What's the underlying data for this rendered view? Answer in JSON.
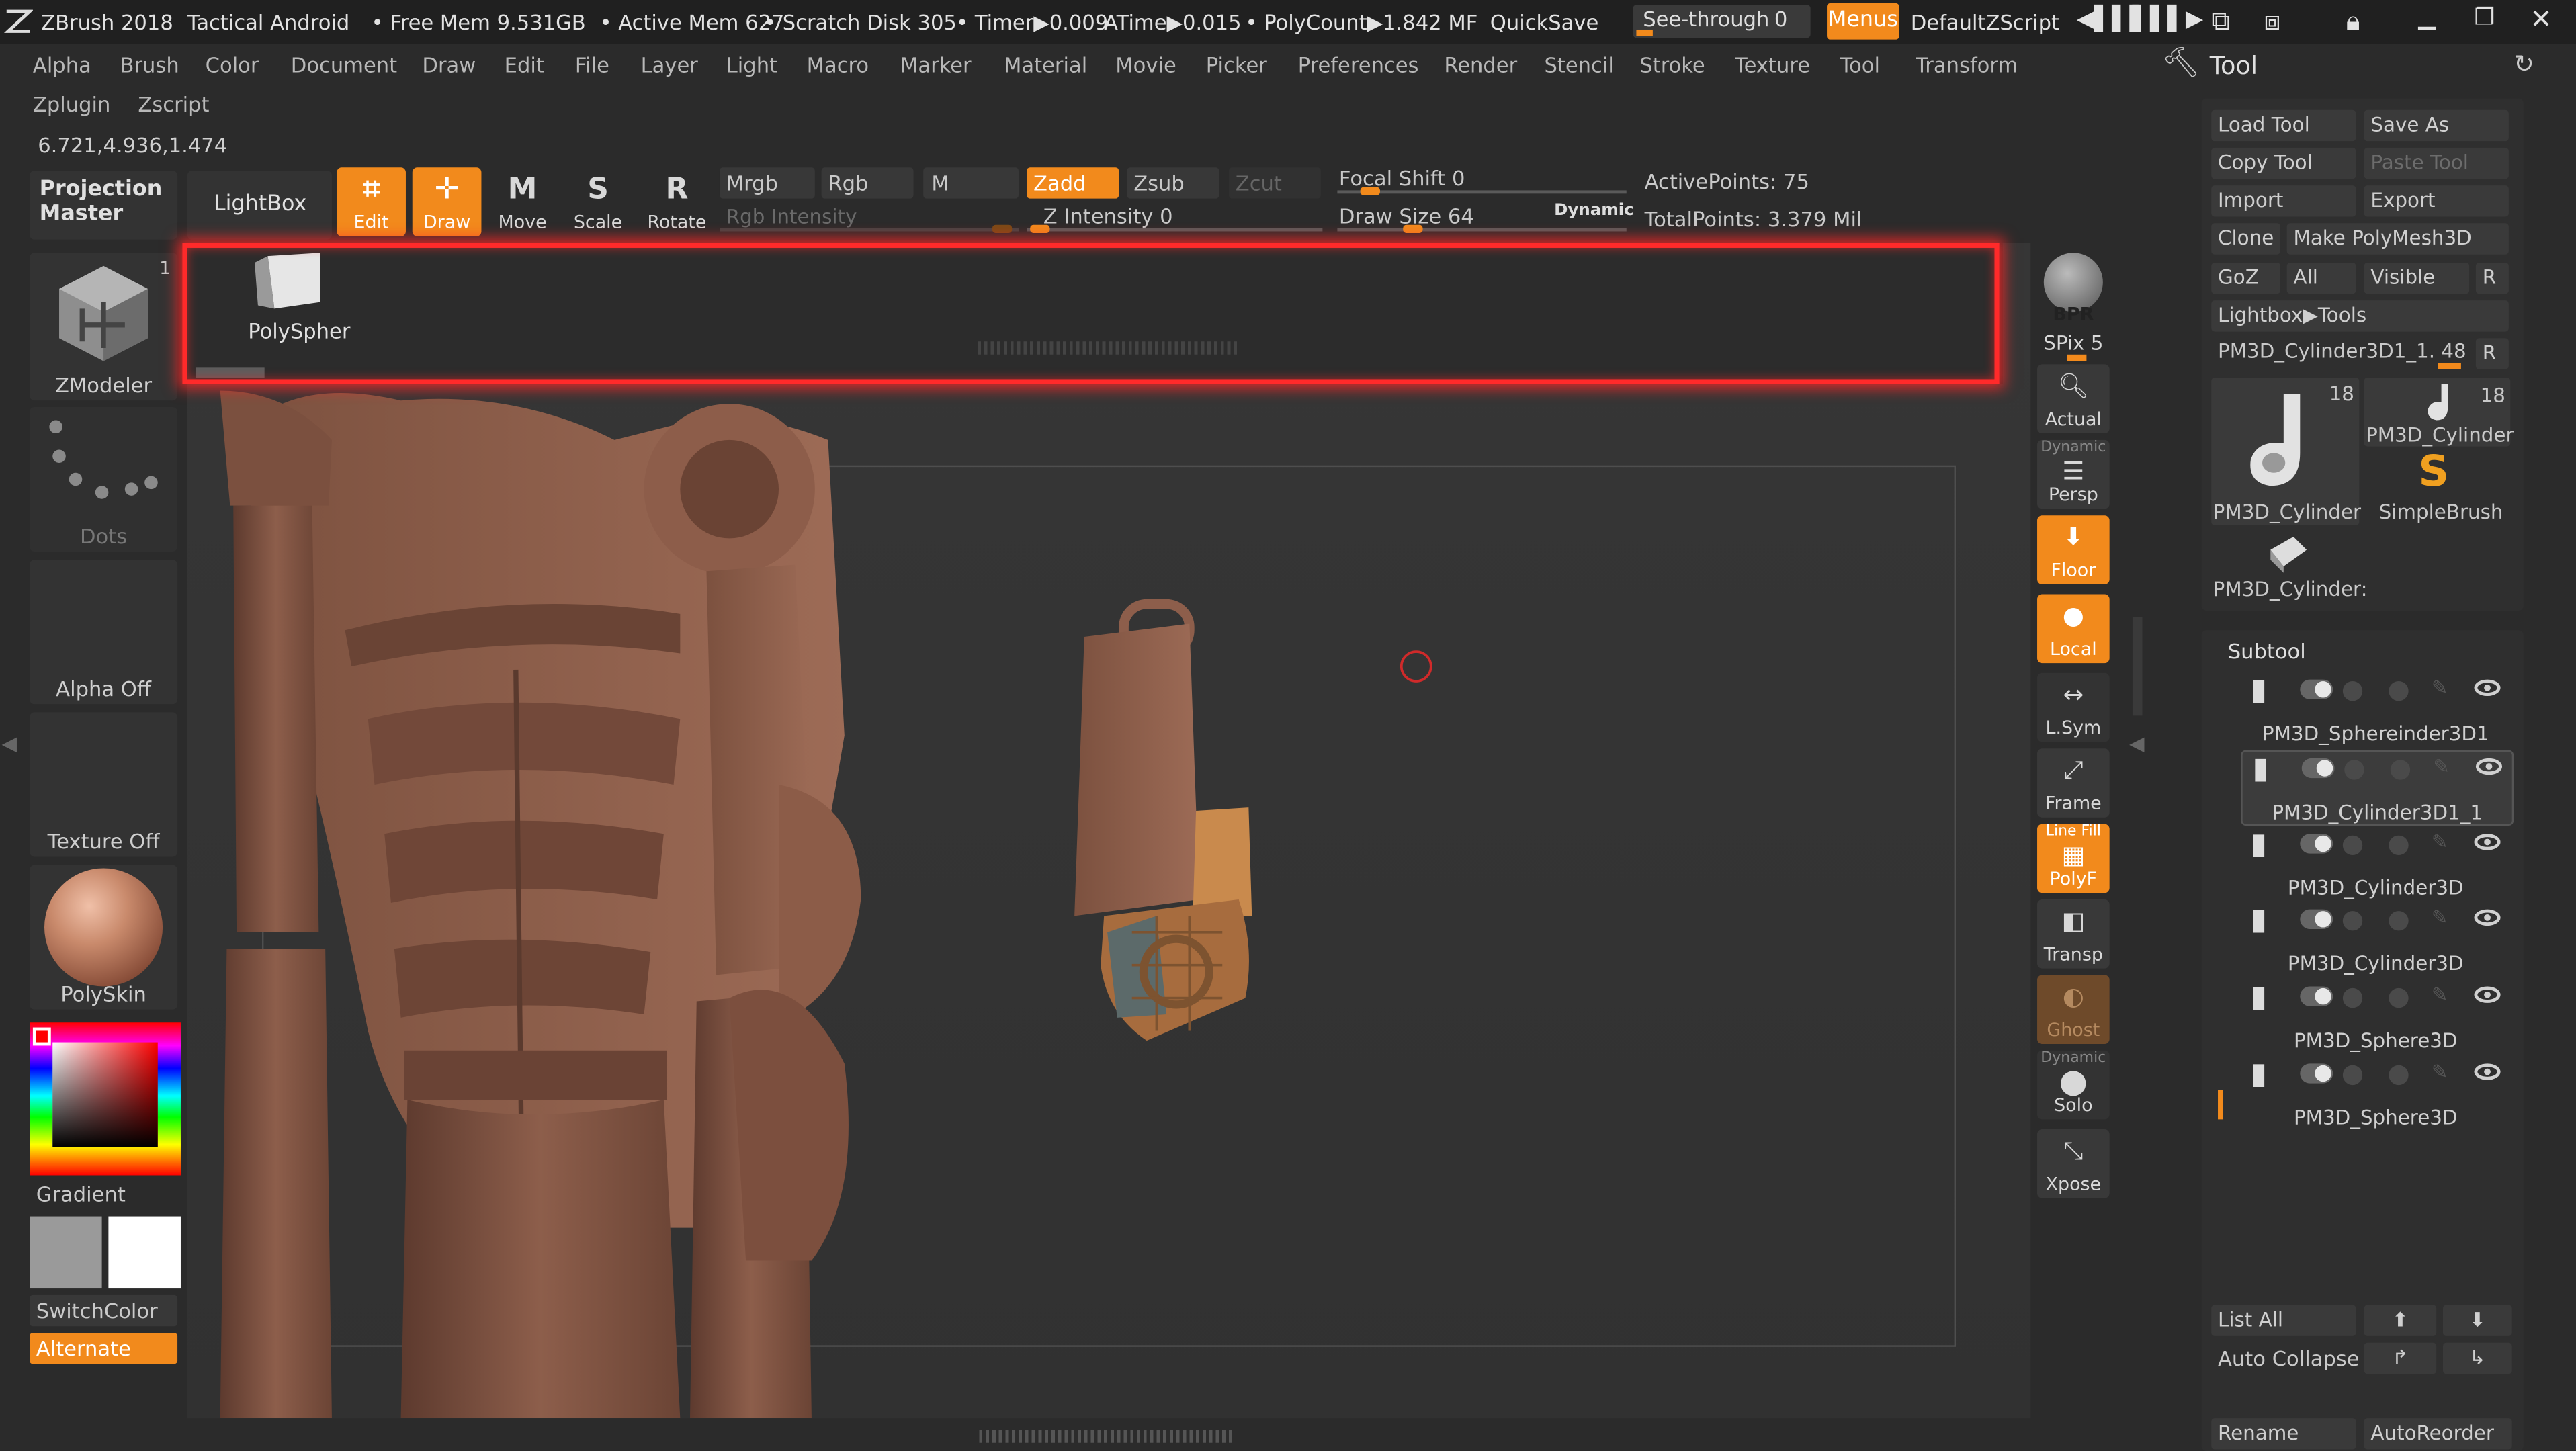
{
  "title": {
    "app": "ZBrush 2018",
    "project": "Tactical Android",
    "free_mem": "• Free Mem 9.531GB",
    "active_mem": "• Active Mem 627",
    "scratch": "• Scratch Disk 305",
    "timer": "• Timer▶0.009",
    "atime": "ATime▶0.015",
    "polycount": "• PolyCount▶1.842 MF",
    "quicksave": "QuickSave",
    "seethrough": "See-through",
    "seethrough_val": "0",
    "menus": "Menus",
    "script": "DefaultZScript"
  },
  "menus": [
    "Alpha",
    "Brush",
    "Color",
    "Document",
    "Draw",
    "Edit",
    "File",
    "Layer",
    "Light",
    "Macro",
    "Marker",
    "Material",
    "Movie",
    "Picker",
    "Preferences",
    "Render",
    "Stencil",
    "Stroke",
    "Texture",
    "Tool",
    "Transform"
  ],
  "menus2": [
    "Zplugin",
    "Zscript"
  ],
  "coords": "6.721,4.936,1.474",
  "toolbar": {
    "projection_master": "Projection Master",
    "lightbox": "LightBox",
    "edit": "Edit",
    "draw": "Draw",
    "move": "Move",
    "scale": "Scale",
    "rotate": "Rotate",
    "mrgb": "Mrgb",
    "rgb": "Rgb",
    "m": "M",
    "zadd": "Zadd",
    "zsub": "Zsub",
    "zcut": "Zcut",
    "rgb_intensity": "Rgb Intensity",
    "z_intensity": "Z Intensity 0",
    "focal_shift": "Focal Shift 0",
    "draw_size": "Draw Size 64",
    "dynamic": "Dynamic",
    "active_points": "ActivePoints: 75",
    "total_points": "TotalPoints: 3.379 Mil",
    "z_intensity_level": 0,
    "focal_shift_level": 0.1,
    "draw_size_level": 0.35
  },
  "lightbox": {
    "item": "PolySpher"
  },
  "left": {
    "zmodeler": "ZModeler",
    "zmodeler_badge": "1",
    "dots": "Dots",
    "alpha": "Alpha Off",
    "texture": "Texture Off",
    "material": "PolySkin",
    "gradient": "Gradient",
    "switchcolor": "SwitchColor",
    "alternate": "Alternate"
  },
  "right": {
    "bpr": "BPR",
    "spix": "SPix 5",
    "actual": "Actual",
    "persp_top": "Dynamic",
    "persp": "Persp",
    "floor": "Floor",
    "local": "Local",
    "lsym": "L.Sym",
    "frame": "Frame",
    "polyf_top": "Line Fill",
    "polyf": "PolyF",
    "transp": "Transp",
    "ghost": "Ghost",
    "solo_top": "Dynamic",
    "solo": "Solo",
    "xpose": "Xpose"
  },
  "tool": {
    "header": "Tool",
    "load": "Load Tool",
    "saveas": "Save As",
    "copy": "Copy Tool",
    "paste": "Paste Tool",
    "import": "Import",
    "export": "Export",
    "clone": "Clone",
    "make": "Make PolyMesh3D",
    "goz": "GoZ",
    "all": "All",
    "visible": "Visible",
    "r": "R",
    "lightbox_tools": "Lightbox▶Tools",
    "current": "PM3D_Cylinder3D1_1. 48",
    "thumb1": "PM3D_Cylinder",
    "thumb1_count": "18",
    "thumb2": "PM3D_Cylinder",
    "thumb2_count": "18",
    "thumb3": "SimpleBrush",
    "thumb4": "PM3D_Cylinder:"
  },
  "subtool": {
    "header": "Subtool",
    "items": [
      "PM3D_Sphereinder3D1",
      "PM3D_Cylinder3D1_1",
      "PM3D_Cylinder3D",
      "PM3D_Cylinder3D",
      "PM3D_Sphere3D",
      "PM3D_Sphere3D"
    ],
    "list_all": "List All",
    "auto_collapse": "Auto Collapse",
    "rename": "Rename",
    "autoreorder": "AutoReorder"
  },
  "colors": {
    "accent": "#f28a1c",
    "highlight": "#ff2a2a",
    "skin": "#8a5a48"
  }
}
